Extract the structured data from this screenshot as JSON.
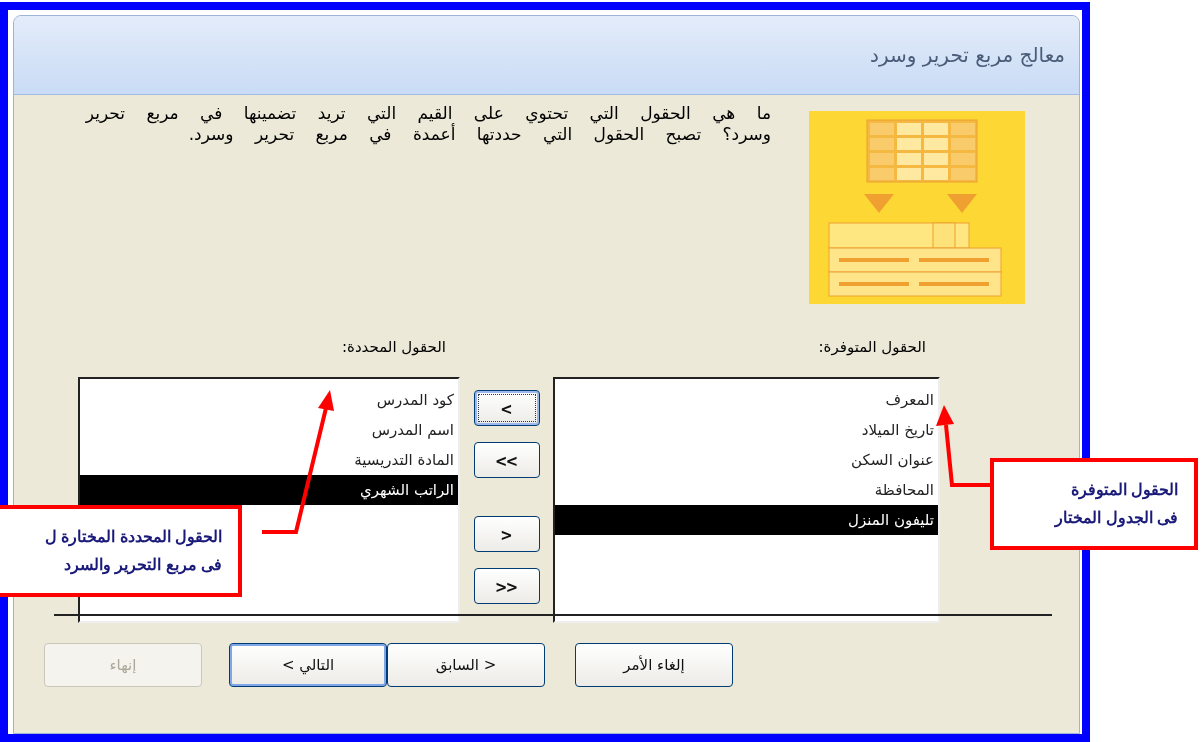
{
  "window": {
    "title": "معالج مربع تحرير وسرد"
  },
  "description": "ما هي الحقول التي تحتوي على القيم التي تريد تضمينها في مربع تحرير وسرد؟ تصبح الحقول التي حددتها أعمدة في مربع تحرير وسرد.",
  "available_fields": {
    "label": "الحقول المتوفرة:",
    "items": [
      {
        "text": "المعرف",
        "selected": false
      },
      {
        "text": "تاريخ الميلاد",
        "selected": false
      },
      {
        "text": "عنوان السكن",
        "selected": false
      },
      {
        "text": "المحافظة",
        "selected": false
      },
      {
        "text": "تليفون المنزل",
        "selected": true
      }
    ]
  },
  "move_buttons": [
    {
      "label": "<",
      "focused": true
    },
    {
      "label": "<<",
      "focused": false
    },
    {
      "label": ">",
      "focused": false
    },
    {
      "label": ">>",
      "focused": false
    }
  ],
  "selected_fields": {
    "label": "الحقول المحددة:",
    "items": [
      {
        "text": "كود المدرس",
        "selected": false
      },
      {
        "text": "اسم المدرس",
        "selected": false
      },
      {
        "text": "المادة التدريسية",
        "selected": false
      },
      {
        "text": "الراتب الشهري",
        "selected": true
      }
    ]
  },
  "buttons": [
    {
      "label": "إلغاء الأمر",
      "disabled": false,
      "default": false
    },
    {
      "label": "< السابق",
      "disabled": false,
      "default": false
    },
    {
      "label": "التالي >",
      "disabled": false,
      "default": true
    },
    {
      "label": "إنهاء",
      "disabled": true,
      "default": false
    }
  ],
  "callouts": [
    {
      "lines": [
        "الحقول المتوفرة",
        "فى الجدول المختار"
      ]
    },
    {
      "lines": [
        "الحقول المحددة المختارة ل",
        "فى مربع التحرير والسرد"
      ]
    }
  ]
}
